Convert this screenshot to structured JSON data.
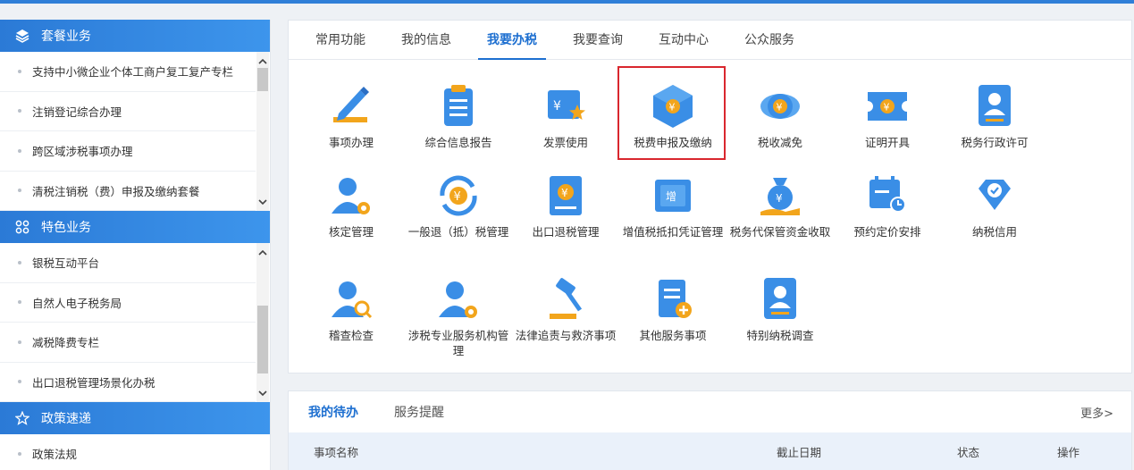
{
  "colors": {
    "accent": "#1d6fd0",
    "sidebar_header": "#2b7ad6",
    "highlight_box": "#d9272e"
  },
  "sidebar": {
    "sections": [
      {
        "title": "套餐业务",
        "icon": "layers-icon",
        "items": [
          "支持中小微企业个体工商户复工复产专栏",
          "注销登记综合办理",
          "跨区域涉税事项办理",
          "清税注销税（费）申报及缴纳套餐"
        ]
      },
      {
        "title": "特色业务",
        "icon": "grid-icon",
        "items": [
          "银税互动平台",
          "自然人电子税务局",
          "减税降费专栏",
          "出口退税管理场景化办税"
        ]
      },
      {
        "title": "政策速递",
        "icon": "star-icon",
        "items": [
          "政策法规"
        ]
      }
    ]
  },
  "tabs": [
    "常用功能",
    "我的信息",
    "我要办税",
    "我要查询",
    "互动中心",
    "公众服务"
  ],
  "active_tab": "我要办税",
  "tiles": [
    {
      "label": "事项办理",
      "icon": "pencil-icon"
    },
    {
      "label": "综合信息报告",
      "icon": "clipboard-icon"
    },
    {
      "label": "发票使用",
      "icon": "invoice-star-icon"
    },
    {
      "label": "税费申报及缴纳",
      "icon": "tax-box-icon"
    },
    {
      "label": "税收减免",
      "icon": "coin-stack-icon"
    },
    {
      "label": "证明开具",
      "icon": "certificate-ticket-icon"
    },
    {
      "label": "税务行政许可",
      "icon": "id-card-icon"
    },
    {
      "label": "核定管理",
      "icon": "user-gear-icon"
    },
    {
      "label": "一般退（抵）税管理",
      "icon": "refund-icon"
    },
    {
      "label": "出口退税管理",
      "icon": "export-book-icon"
    },
    {
      "label": "增值税抵扣凭证管理",
      "icon": "vat-ticket-icon"
    },
    {
      "label": "税务代保管资金收取",
      "icon": "money-bag-icon"
    },
    {
      "label": "预约定价安排",
      "icon": "calendar-clock-icon"
    },
    {
      "label": "纳税信用",
      "icon": "diamond-check-icon"
    },
    {
      "label": "稽查检查",
      "icon": "inspector-icon"
    },
    {
      "label": "涉税专业服务机构管理",
      "icon": "agent-gear-icon"
    },
    {
      "label": "法律追责与救济事项",
      "icon": "gavel-icon"
    },
    {
      "label": "其他服务事项",
      "icon": "doc-add-icon"
    },
    {
      "label": "特别纳税调查",
      "icon": "badge-icon"
    }
  ],
  "todo": {
    "tabs": [
      "我的待办",
      "服务提醒"
    ],
    "more": "更多>",
    "columns": [
      "事项名称",
      "截止日期",
      "状态",
      "操作"
    ]
  }
}
